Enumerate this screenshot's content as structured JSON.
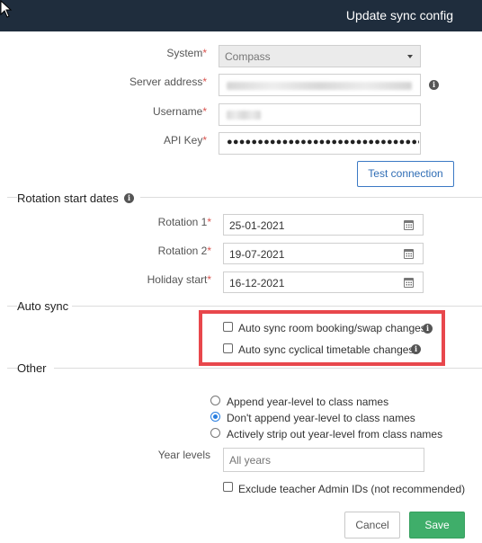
{
  "dialog": {
    "title": "Update sync config"
  },
  "connection": {
    "system_label": "System",
    "system_value": "Compass",
    "server_label": "Server address",
    "username_label": "Username",
    "apikey_label": "API Key",
    "apikey_mask": "●●●●●●●●●●●●●●●●●●●●●●●●●●●●●●●●",
    "test_button": "Test connection",
    "required_mark": "*"
  },
  "rotation": {
    "section_title": "Rotation start dates",
    "rotation1_label": "Rotation 1",
    "rotation1_value": "25-01-2021",
    "rotation2_label": "Rotation 2",
    "rotation2_value": "19-07-2021",
    "holiday_label": "Holiday start",
    "holiday_value": "16-12-2021"
  },
  "autosync": {
    "section_title": "Auto sync",
    "room_booking_label": "Auto sync room booking/swap changes",
    "room_booking_checked": false,
    "cyclical_label": "Auto sync cyclical timetable changes",
    "cyclical_checked": false,
    "highlight_color": "#e8474c"
  },
  "other": {
    "section_title": "Other",
    "radio_options": [
      {
        "label": "Append year-level to class names",
        "checked": false
      },
      {
        "label": "Don't append year-level to class names",
        "checked": true
      },
      {
        "label": "Actively strip out year-level from class names",
        "checked": false
      }
    ],
    "year_levels_label": "Year levels",
    "year_levels_placeholder": "All years",
    "exclude_label": "Exclude teacher Admin IDs (not recommended)",
    "exclude_checked": false
  },
  "footer": {
    "cancel": "Cancel",
    "save": "Save"
  },
  "colors": {
    "header_bg": "#1f2d3d",
    "save_green": "#3fae6a",
    "link_blue": "#2f6db5",
    "radio_blue": "#2a7fe0"
  }
}
